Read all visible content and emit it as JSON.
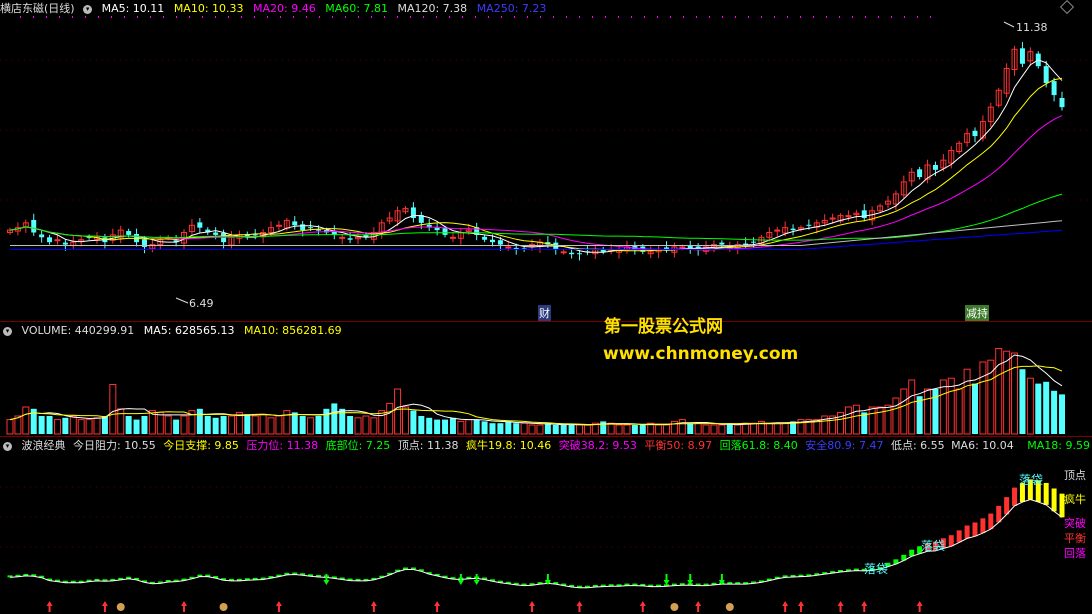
{
  "price_header": {
    "title": "横店东磁(日线)",
    "ma5": "MA5: 10.11",
    "ma10": "MA10: 10.33",
    "ma20": "MA20: 9.46",
    "ma60": "MA60: 7.81",
    "ma120": "MA120: 7.38",
    "ma250": "MA250: 7.23"
  },
  "volume_header": {
    "volume": "VOLUME: 440299.91",
    "ma5": "MA5: 628565.13",
    "ma10": "MA10: 856281.69"
  },
  "wave_header": {
    "name": "波浪经典",
    "resist": "今日阻力: 10.55",
    "support": "今日支撑: 9.85",
    "pressure": "压力位: 11.38",
    "bottom": "底部位: 7.25",
    "top": "顶点: 11.38",
    "crazy": "疯牛19.8: 10.46",
    "breakout": "突破38.2: 9.53",
    "balance": "平衡50: 8.97",
    "pullback": "回落61.8: 8.40",
    "safe": "安全80.9: 7.47",
    "low": "低点: 6.55",
    "ma6": "MA6: 10.04",
    "ma18": "MA18: 9.59"
  },
  "annotations": {
    "high": "11.38",
    "low": "6.49",
    "cai": "财",
    "jian_chi": "减持"
  },
  "watermark": {
    "line1": "第一股票公式网",
    "line2": "www.chnmoney.com"
  },
  "wave_labels": {
    "ding_dian": "顶点",
    "feng_niu": "疯牛",
    "tu_po": "突破",
    "ping_heng": "平衡",
    "hui_luo": "回落",
    "luo_dai_1": "落袋",
    "luo_dai_2": "落袋",
    "luo_dai_3": "落袋"
  },
  "colors": {
    "up": "#ff3232",
    "down": "#54ffff",
    "ma5": "#ffffff",
    "ma10": "#ffff00",
    "ma20": "#ff00ff",
    "ma60": "#00ff00",
    "ma120": "#c0c0c0",
    "ma250": "#0000ff"
  },
  "chart_data": {
    "type": "candlestick",
    "price_range": [
      6.0,
      11.6
    ],
    "high": 11.38,
    "low": 6.49,
    "closes": [
      7.45,
      7.5,
      7.6,
      7.4,
      7.3,
      7.2,
      7.25,
      7.15,
      7.2,
      7.25,
      7.3,
      7.3,
      7.2,
      7.35,
      7.45,
      7.35,
      7.2,
      7.1,
      7.15,
      7.25,
      7.3,
      7.2,
      7.4,
      7.55,
      7.5,
      7.4,
      7.35,
      7.2,
      7.3,
      7.35,
      7.3,
      7.35,
      7.4,
      7.5,
      7.55,
      7.65,
      7.55,
      7.45,
      7.5,
      7.45,
      7.4,
      7.35,
      7.3,
      7.25,
      7.3,
      7.3,
      7.4,
      7.6,
      7.7,
      7.85,
      7.9,
      7.7,
      7.6,
      7.5,
      7.45,
      7.35,
      7.3,
      7.4,
      7.45,
      7.35,
      7.25,
      7.2,
      7.15,
      7.1,
      7.05,
      7.05,
      7.15,
      7.2,
      7.15,
      7.05,
      7.0,
      6.95,
      6.95,
      7.0,
      7.05,
      7.0,
      7.05,
      7.05,
      7.1,
      7.05,
      7.0,
      7.0,
      7.05,
      7.05,
      7.1,
      7.1,
      7.05,
      7.05,
      7.1,
      7.15,
      7.15,
      7.1,
      7.15,
      7.15,
      7.2,
      7.3,
      7.4,
      7.45,
      7.5,
      7.45,
      7.5,
      7.55,
      7.6,
      7.65,
      7.7,
      7.75,
      7.75,
      7.8,
      7.7,
      7.85,
      7.95,
      8.05,
      8.2,
      8.45,
      8.65,
      8.55,
      8.8,
      8.7,
      8.9,
      9.1,
      9.25,
      9.45,
      9.4,
      9.7,
      10.0,
      10.35,
      10.8,
      11.2,
      10.9,
      11.15,
      10.85,
      10.5,
      10.25,
      10.0
    ],
    "volumes": [
      0.16,
      0.2,
      0.3,
      0.28,
      0.2,
      0.2,
      0.16,
      0.18,
      0.2,
      0.16,
      0.16,
      0.18,
      0.2,
      0.55,
      0.28,
      0.2,
      0.16,
      0.2,
      0.26,
      0.24,
      0.2,
      0.16,
      0.2,
      0.26,
      0.28,
      0.2,
      0.18,
      0.2,
      0.2,
      0.24,
      0.22,
      0.2,
      0.22,
      0.18,
      0.2,
      0.26,
      0.24,
      0.2,
      0.18,
      0.2,
      0.28,
      0.34,
      0.28,
      0.2,
      0.18,
      0.2,
      0.18,
      0.26,
      0.34,
      0.5,
      0.3,
      0.26,
      0.2,
      0.18,
      0.16,
      0.16,
      0.18,
      0.14,
      0.16,
      0.16,
      0.14,
      0.12,
      0.12,
      0.14,
      0.12,
      0.12,
      0.1,
      0.1,
      0.12,
      0.1,
      0.1,
      0.1,
      0.1,
      0.1,
      0.12,
      0.14,
      0.12,
      0.1,
      0.1,
      0.1,
      0.1,
      0.12,
      0.1,
      0.1,
      0.14,
      0.16,
      0.12,
      0.12,
      0.1,
      0.1,
      0.1,
      0.12,
      0.1,
      0.12,
      0.12,
      0.14,
      0.12,
      0.12,
      0.12,
      0.14,
      0.16,
      0.16,
      0.16,
      0.2,
      0.2,
      0.24,
      0.3,
      0.32,
      0.24,
      0.3,
      0.3,
      0.32,
      0.4,
      0.5,
      0.6,
      0.42,
      0.5,
      0.5,
      0.6,
      0.62,
      0.5,
      0.72,
      0.56,
      0.8,
      0.82,
      0.95,
      0.92,
      0.9,
      0.72,
      0.62,
      0.56,
      0.58,
      0.48,
      0.44
    ]
  }
}
